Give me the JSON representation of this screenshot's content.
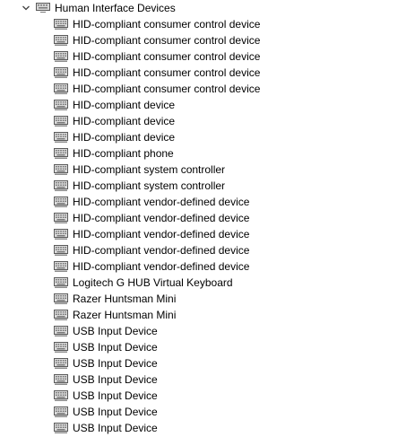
{
  "category": {
    "label": "Human Interface Devices",
    "expanded": true,
    "expander_icon": "chevron-down-icon",
    "icon": "hid-keyboard-icon"
  },
  "devices": [
    {
      "label": "HID-compliant consumer control device",
      "icon": "hid-device-icon"
    },
    {
      "label": "HID-compliant consumer control device",
      "icon": "hid-device-icon"
    },
    {
      "label": "HID-compliant consumer control device",
      "icon": "hid-device-icon"
    },
    {
      "label": "HID-compliant consumer control device",
      "icon": "hid-device-icon"
    },
    {
      "label": "HID-compliant consumer control device",
      "icon": "hid-device-icon"
    },
    {
      "label": "HID-compliant device",
      "icon": "hid-device-icon"
    },
    {
      "label": "HID-compliant device",
      "icon": "hid-device-icon"
    },
    {
      "label": "HID-compliant device",
      "icon": "hid-device-icon"
    },
    {
      "label": "HID-compliant phone",
      "icon": "hid-device-icon"
    },
    {
      "label": "HID-compliant system controller",
      "icon": "hid-device-icon"
    },
    {
      "label": "HID-compliant system controller",
      "icon": "hid-device-icon"
    },
    {
      "label": "HID-compliant vendor-defined device",
      "icon": "hid-device-icon"
    },
    {
      "label": "HID-compliant vendor-defined device",
      "icon": "hid-device-icon"
    },
    {
      "label": "HID-compliant vendor-defined device",
      "icon": "hid-device-icon"
    },
    {
      "label": "HID-compliant vendor-defined device",
      "icon": "hid-device-icon"
    },
    {
      "label": "HID-compliant vendor-defined device",
      "icon": "hid-device-icon"
    },
    {
      "label": "Logitech G HUB Virtual Keyboard",
      "icon": "hid-device-icon"
    },
    {
      "label": "Razer Huntsman Mini",
      "icon": "hid-device-icon"
    },
    {
      "label": "Razer Huntsman Mini",
      "icon": "hid-device-icon"
    },
    {
      "label": "USB Input Device",
      "icon": "hid-device-icon"
    },
    {
      "label": "USB Input Device",
      "icon": "hid-device-icon"
    },
    {
      "label": "USB Input Device",
      "icon": "hid-device-icon"
    },
    {
      "label": "USB Input Device",
      "icon": "hid-device-icon"
    },
    {
      "label": "USB Input Device",
      "icon": "hid-device-icon"
    },
    {
      "label": "USB Input Device",
      "icon": "hid-device-icon"
    },
    {
      "label": "USB Input Device",
      "icon": "hid-device-icon"
    }
  ],
  "colors": {
    "text": "#000000",
    "chevron": "#404040",
    "icon_body": "#d7d7d7",
    "icon_outline": "#5a5a5a",
    "icon_keys": "#7a7a7a"
  }
}
